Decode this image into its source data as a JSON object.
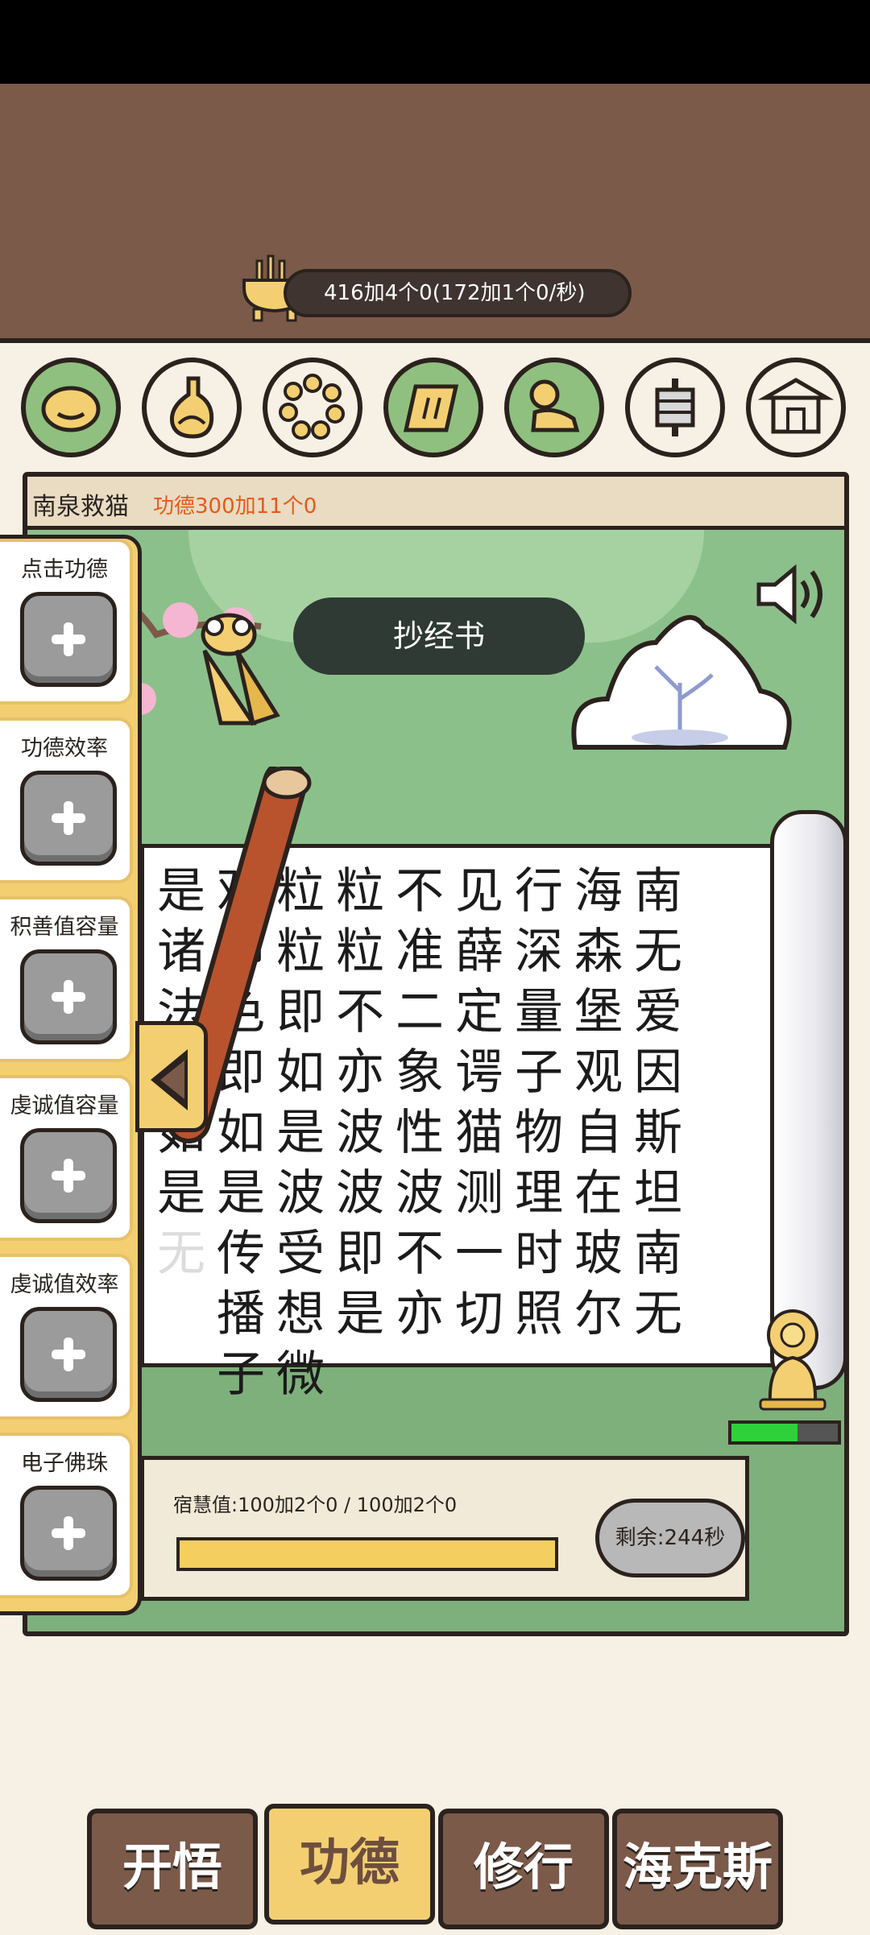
{
  "header": {
    "merit_counter": "416加4个0(172加1个0/秒)",
    "icon": "incense-burner-icon"
  },
  "top_buttons": [
    {
      "name": "wooden-fish-icon",
      "color": "#8fc07f"
    },
    {
      "name": "bottle-icon",
      "color": "#f6f1e4"
    },
    {
      "name": "prayer-beads-icon",
      "color": "#f6f1e4"
    },
    {
      "name": "scroll-icon",
      "color": "#8fc07f"
    },
    {
      "name": "monk-bow-icon",
      "color": "#8fc07f"
    },
    {
      "name": "bell-icon",
      "color": "#f6f1e4"
    },
    {
      "name": "temple-icon",
      "color": "#f6f1e4"
    }
  ],
  "panel": {
    "title": "南泉救猫",
    "subtitle": "功德300加11个0",
    "action_label": "抄经书",
    "sound_icon": "speaker-icon"
  },
  "scripture_columns": [
    [
      "是",
      "诸",
      "法",
      "空",
      "如",
      "是",
      "无"
    ],
    [
      "观",
      "即",
      "色",
      "即",
      "如",
      "是",
      "传",
      "播",
      "子"
    ],
    [
      "粒",
      "粒",
      "即",
      "如",
      "是",
      "波",
      "受",
      "想",
      "微"
    ],
    [
      "粒",
      "粒",
      "不",
      "亦",
      "波",
      "波",
      "即",
      "是"
    ],
    [
      "不",
      "准",
      "二",
      "象",
      "性",
      "波",
      "不",
      "亦"
    ],
    [
      "见",
      "薛",
      "定",
      "谔",
      "猫",
      "测",
      "一",
      "切"
    ],
    [
      "行",
      "深",
      "量",
      "子",
      "物",
      "理",
      "时",
      "照"
    ],
    [
      "海",
      "森",
      "堡",
      "观",
      "自",
      "在",
      "玻",
      "尔"
    ],
    [
      "南",
      "无",
      "爱",
      "因",
      "斯",
      "坦",
      "南",
      "无"
    ]
  ],
  "wisdom": {
    "label": "宿慧值:100加2个0 / 100加2个0",
    "fill": 1.0
  },
  "remaining": "剩余:244秒",
  "buddha_health": 0.62,
  "side_items": [
    {
      "label": "点击功德"
    },
    {
      "label": "功德效率"
    },
    {
      "label": "积善值容量"
    },
    {
      "label": "虔诚值容量"
    },
    {
      "label": "虔诚值效率"
    },
    {
      "label": "电子佛珠"
    }
  ],
  "bottom_nav": [
    {
      "label": "开悟",
      "active": false
    },
    {
      "label": "功德",
      "active": true
    },
    {
      "label": "修行",
      "active": false
    },
    {
      "label": "海克斯",
      "active": false
    }
  ]
}
